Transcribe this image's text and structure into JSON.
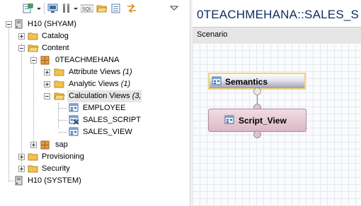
{
  "toolbar": {
    "buttons": [
      "new-icon",
      "dropdown-arrow-icon",
      "monitor-icon",
      "tools-icon",
      "dropdown-arrow-icon",
      "sql-icon",
      "open-folder-icon",
      "collapse-icon",
      "link-icon",
      "view-menu-icon"
    ],
    "sql_label": "SQL"
  },
  "tree": {
    "h10_shyam": "H10 (SHYAM)",
    "catalog": "Catalog",
    "content": "Content",
    "package": "0TEACHMEHANA",
    "attribute_views": "Attribute Views",
    "attribute_views_count": "(1)",
    "analytic_views": "Analytic Views",
    "analytic_views_count": "(1)",
    "calculation_views": "Calculation Views",
    "calculation_views_count": "(3,",
    "employee": "EMPLOYEE",
    "sales_script": "SALES_SCRIPT",
    "sales_view": "SALES_VIEW",
    "sap": "sap",
    "provisioning": "Provisioning",
    "security": "Security",
    "h10_system": "H10 (SYSTEM)"
  },
  "editor": {
    "title": "0TEACHMEHANA::SALES_S",
    "tab": "Scenario",
    "nodes": {
      "semantics": "Semantics",
      "script_view": "Script_View"
    }
  },
  "colors": {
    "title_blue": "#0d2d62",
    "folder_yellow": "#f2c14e",
    "package_orange": "#d4822a",
    "script_view_fill": "#dcb8c4",
    "semantics_border": "#f3d27a"
  }
}
